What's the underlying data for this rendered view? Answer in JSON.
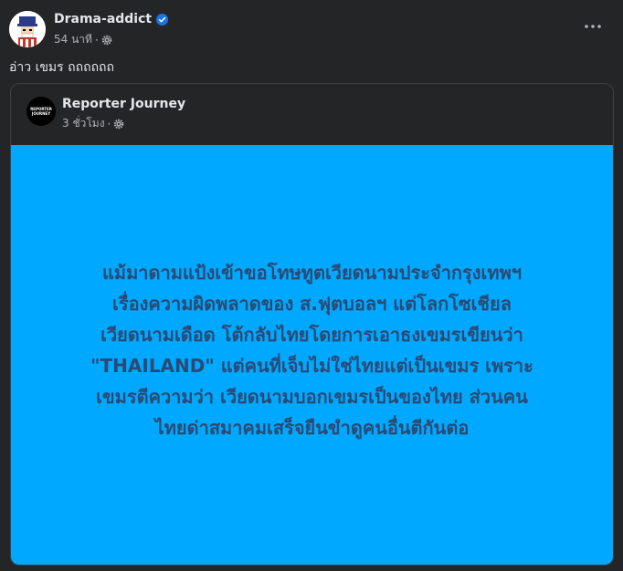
{
  "post": {
    "author": "Drama-addict",
    "time": "54 นาที",
    "separator": "·",
    "caption": "อ่าว เขมร ถถถถถถ"
  },
  "shared": {
    "page_name": "Reporter Journey",
    "time": "3 ชั่วโมง",
    "separator": "·",
    "logo_line1": "REPORTER",
    "logo_line2": "JOURNEY",
    "lines": [
      "แม้มาดามแป้งเข้าขอโทษทูตเวียดนามประจำกรุงเทพฯ",
      "เรื่องความผิดพลาดของ ส.ฟุตบอลฯ แต่โลกโซเชียล",
      "เวียดนามเดือด โต้กลับไทยโดยการเอาธงเขมรเขียนว่า",
      "\"THAILAND\" แต่คนที่เจ็บไม่ใช่ไทยแต่เป็นเขมร เพราะ",
      "เขมรตีความว่า เวียดนามบอกเขมรเป็นของไทย ส่วนคน",
      "ไทยด่าสมาคมเสร็จยืนขำดูคนอื่นตีกันต่อ"
    ]
  },
  "colors": {
    "background": "#242526",
    "panel": "#00a8ff",
    "panel_text": "#2b4a73",
    "verified": "#1b74e4"
  },
  "icons": {
    "verified": "verified-badge-icon",
    "privacy": "gear-icon",
    "more": "more-options-icon"
  }
}
